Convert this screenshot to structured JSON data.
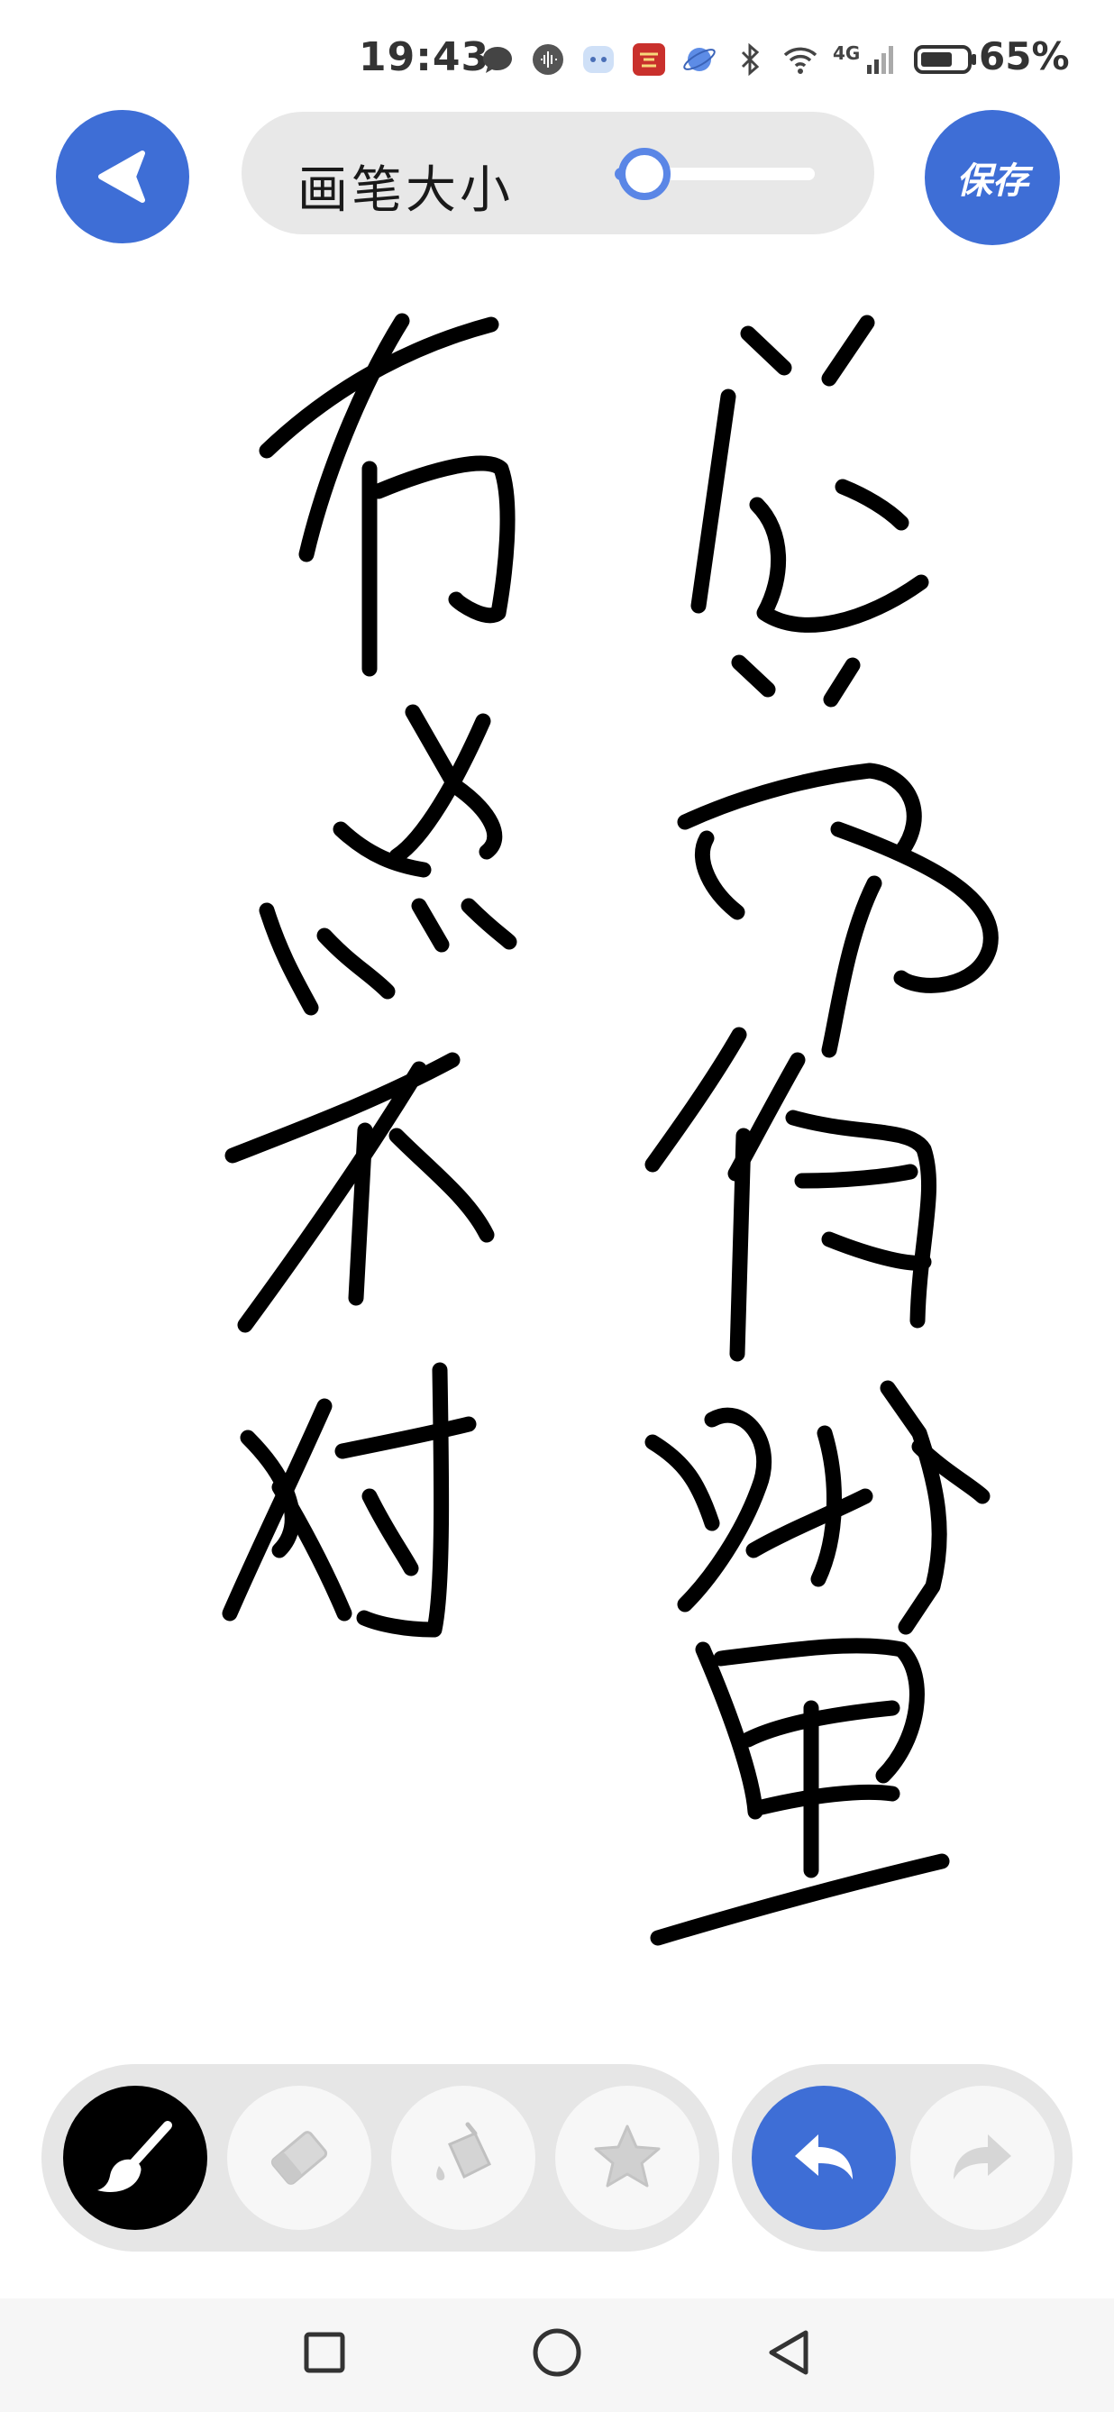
{
  "status_bar": {
    "time": "19:43",
    "battery_percent": "65%",
    "network": "4G"
  },
  "header": {
    "brush_size_label": "画笔大小",
    "brush_size_level": 0.15,
    "save_label": "保存"
  },
  "canvas": {
    "handwritten_text_right": "总觉得哪里",
    "handwritten_text_left": "有点不对"
  },
  "toolbar": {
    "tools": [
      "brush-icon",
      "eraser-icon",
      "paint-bucket-icon",
      "star-icon"
    ],
    "active_tool": "brush-icon",
    "history": [
      "undo-icon",
      "redo-icon"
    ]
  },
  "colors": {
    "accent": "#3e6ed6",
    "pill_bg": "#e6e6e6",
    "ink": "#000000"
  }
}
